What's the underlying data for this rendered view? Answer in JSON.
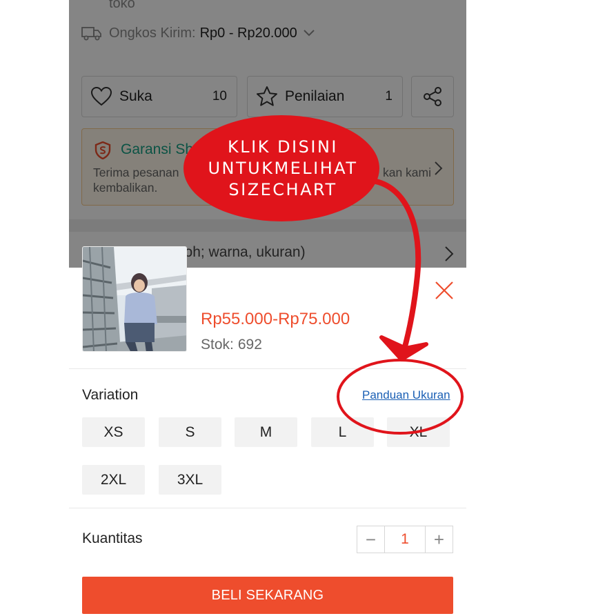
{
  "background_page": {
    "top_text": "toko",
    "shipping": {
      "label": "Ongkos Kirim:",
      "value": "Rp0 - Rp20.000"
    },
    "actions": {
      "like_label": "Suka",
      "like_count": "10",
      "rating_label": "Penilaian",
      "rating_count": "1"
    },
    "guarantee": {
      "title": "Garansi Sh",
      "line1": "Terima pesanan",
      "line1_end": "kan kami",
      "line2": "kembalikan."
    },
    "variant_hint": "ntoh; warna, ukuran)"
  },
  "annotation": {
    "lines": [
      "KLIK DISINI",
      "UNTUKMELIHAT",
      "SIZECHART"
    ],
    "color": "#e0141b"
  },
  "product": {
    "price": "Rp55.000-Rp75.000",
    "stock_label": "Stok:",
    "stock_value": "692"
  },
  "variation": {
    "label": "Variation",
    "size_guide_link": "Panduan Ukuran",
    "options": [
      "XS",
      "S",
      "M",
      "L",
      "XL",
      "2XL",
      "3XL"
    ]
  },
  "quantity": {
    "label": "Kuantitas",
    "minus": "−",
    "value": "1",
    "plus": "+"
  },
  "buy_button": "BELI SEKARANG",
  "colors": {
    "accent": "#ee4d2d",
    "link": "#1a5fb4",
    "guarantee_green": "#17a085"
  },
  "icons": [
    "truck-icon",
    "chevron-down-icon",
    "heart-icon",
    "star-icon",
    "share-icon",
    "shield-icon",
    "chevron-right-icon",
    "close-icon"
  ]
}
